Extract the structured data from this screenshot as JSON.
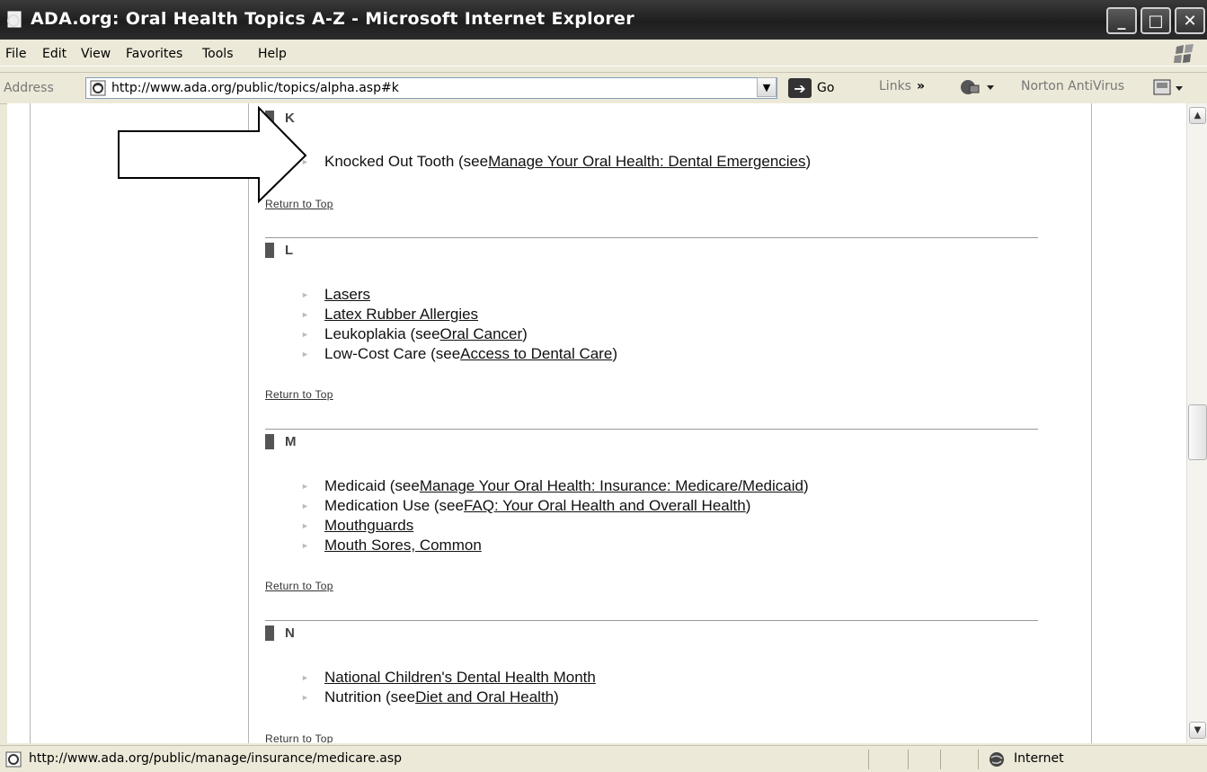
{
  "window": {
    "title": "ADA.org: Oral Health Topics A-Z - Microsoft Internet Explorer",
    "buttons": {
      "minimize": "_",
      "maximize": "□",
      "close": "✕"
    }
  },
  "menu": [
    "File",
    "Edit",
    "View",
    "Favorites",
    "Tools",
    "Help"
  ],
  "address_bar": {
    "label": "Address",
    "url": "http://www.ada.org/public/topics/alpha.asp#k",
    "go_label": "Go",
    "links_label": "Links",
    "links_more": "»",
    "norton_label": "Norton AntiVirus"
  },
  "sections": [
    {
      "letter": "K",
      "items": [
        {
          "text": "Knocked Out Tooth (see ",
          "link": "Manage Your Oral Health: Dental Emergencies",
          "suffix": ")"
        }
      ],
      "return_label": "Return to Top"
    },
    {
      "letter": "L",
      "items": [
        {
          "text": "",
          "link": "Lasers",
          "suffix": ""
        },
        {
          "text": "",
          "link": "Latex Rubber Allergies",
          "suffix": ""
        },
        {
          "text": "Leukoplakia (see ",
          "link": "Oral Cancer",
          "suffix": ")"
        },
        {
          "text": "Low-Cost Care (see ",
          "link": "Access to Dental Care",
          "suffix": ")"
        }
      ],
      "return_label": "Return to Top"
    },
    {
      "letter": "M",
      "items": [
        {
          "text": "Medicaid (see ",
          "link": "Manage Your Oral Health: Insurance: Medicare/Medicaid",
          "suffix": ")"
        },
        {
          "text": "Medication Use (see ",
          "link": "FAQ: Your Oral Health and Overall Health",
          "suffix": ")"
        },
        {
          "text": "",
          "link": "Mouthguards",
          "suffix": ""
        },
        {
          "text": "",
          "link": "Mouth Sores, Common",
          "suffix": ""
        }
      ],
      "return_label": "Return to Top"
    },
    {
      "letter": "N",
      "items": [
        {
          "text": "",
          "link": "National Children's Dental Health Month",
          "suffix": ""
        },
        {
          "text": "Nutrition (see ",
          "link": "Diet and Oral Health",
          "suffix": ")"
        }
      ],
      "return_label": "Return to Top"
    }
  ],
  "status_bar": {
    "text": "http://www.ada.org/public/manage/insurance/medicare.asp",
    "zone": "Internet"
  }
}
